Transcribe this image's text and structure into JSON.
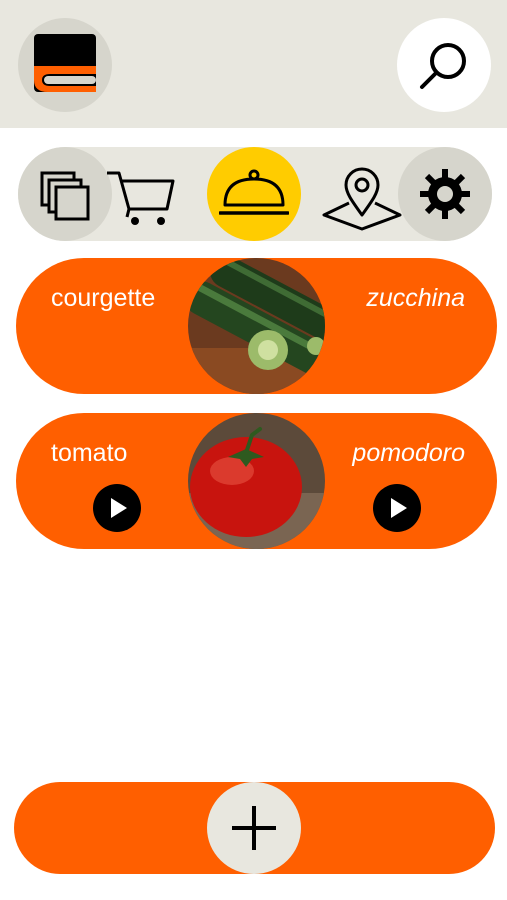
{
  "header": {
    "logo_icon": "dictionary-book-icon",
    "search_icon": "search-icon"
  },
  "nav": {
    "items": [
      {
        "icon": "flashcards-icon",
        "active": false
      },
      {
        "icon": "shopping-cart-icon",
        "active": false
      },
      {
        "icon": "serving-dish-icon",
        "active": true
      },
      {
        "icon": "map-pin-icon",
        "active": false
      },
      {
        "icon": "gear-icon",
        "active": false
      }
    ]
  },
  "words": [
    {
      "english": "courgette",
      "italian": "zucchina",
      "image": "courgette-photo",
      "has_audio": false
    },
    {
      "english": "tomato",
      "italian": "pomodoro",
      "image": "tomato-photo",
      "has_audio": true
    }
  ],
  "footer": {
    "add_icon": "plus-icon"
  },
  "colors": {
    "accent": "#ff5f00",
    "active_nav": "#ffcc00",
    "header_bg": "#e8e7df",
    "circle_bg": "#d6d5cc"
  }
}
